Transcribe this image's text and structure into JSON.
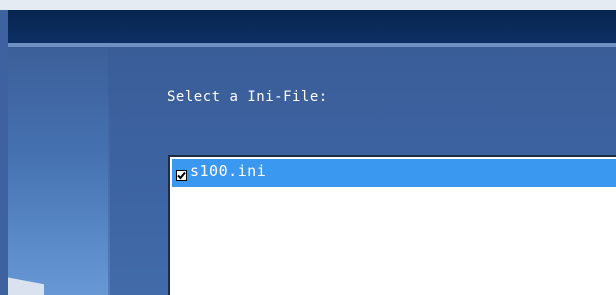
{
  "dialog": {
    "prompt_label": "Select a Ini-File:",
    "file_list": [
      {
        "name": "s100.ini",
        "checked": true,
        "selected": true
      }
    ]
  },
  "icons": {
    "checkbox": "check-icon"
  },
  "colors": {
    "selection": "#3a98f0",
    "titlebar": "#0a2a58",
    "panel": "#3d64a2"
  }
}
